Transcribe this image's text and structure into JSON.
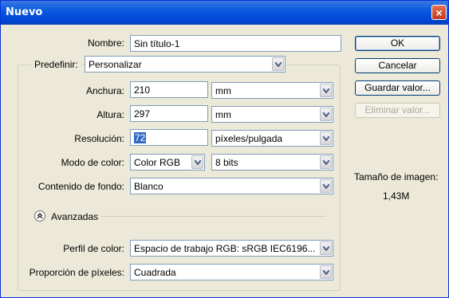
{
  "window": {
    "title": "Nuevo",
    "close": "×"
  },
  "form": {
    "nombre": {
      "label": "Nombre:",
      "value": "Sin título-1"
    },
    "predefinir": {
      "label": "Predefinir:",
      "value": "Personalizar"
    },
    "anchura": {
      "label": "Anchura:",
      "value": "210",
      "unit": "mm"
    },
    "altura": {
      "label": "Altura:",
      "value": "297",
      "unit": "mm"
    },
    "resolucion": {
      "label": "Resolución:",
      "value": "72",
      "unit": "píxeles/pulgada"
    },
    "modo_color": {
      "label": "Modo de color:",
      "value": "Color RGB",
      "bits": "8 bits"
    },
    "contenido_fondo": {
      "label": "Contenido de fondo:",
      "value": "Blanco"
    },
    "avanzadas": {
      "label": "Avanzadas"
    },
    "perfil_color": {
      "label": "Perfil de color:",
      "value": "Espacio de trabajo RGB: sRGB IEC6196..."
    },
    "proporcion_pixeles": {
      "label": "Proporción de píxeles:",
      "value": "Cuadrada"
    }
  },
  "buttons": {
    "ok": "OK",
    "cancelar": "Cancelar",
    "guardar": "Guardar valor...",
    "eliminar": "Eliminar valor..."
  },
  "image_size": {
    "label": "Tamaño de imagen:",
    "value": "1,43M"
  }
}
